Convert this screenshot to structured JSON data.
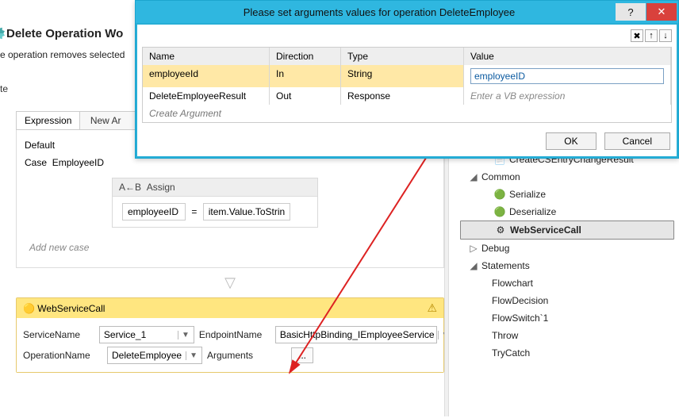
{
  "background": {
    "title": "Delete Operation Wo",
    "desc": "e operation removes selected",
    "te": "te"
  },
  "workflow": {
    "tab_expression": "Expression",
    "tab_newaction": "New Ar",
    "default_label": "Default",
    "case_label": "Case",
    "case_value": "EmployeeID",
    "assign": {
      "title": "Assign",
      "heading_icon": "A←B",
      "left": "employeeID",
      "eq": "=",
      "right": "item.Value.ToStrin"
    },
    "add_new_case": "Add new case",
    "down_glyph": "▽"
  },
  "service_call": {
    "title": "WebServiceCall",
    "warn_glyph": "⚠",
    "rows": {
      "service_name_label": "ServiceName",
      "service_name_value": "Service_1",
      "endpoint_label": "EndpointName",
      "endpoint_value": "BasicHttpBinding_IEmployeeService",
      "operation_label": "OperationName",
      "operation_value": "DeleteEmployee",
      "arguments_label": "Arguments",
      "arguments_value": "..."
    }
  },
  "tree": {
    "items": [
      {
        "icon": "",
        "label": "CreateCSEntryChangeResult",
        "caret": "",
        "indent": "indent2"
      },
      {
        "icon": "",
        "label": "Common",
        "caret": "◢",
        "indent": "indent1"
      },
      {
        "icon": "",
        "label": "Serialize",
        "caret": "",
        "indent": "indent2"
      },
      {
        "icon": "",
        "label": "Deserialize",
        "caret": "",
        "indent": "indent2"
      },
      {
        "icon": "",
        "label": "WebServiceCall",
        "caret": "",
        "indent": "indent2",
        "sel": true,
        "bold": true
      },
      {
        "icon": "",
        "label": "Debug",
        "caret": "▷",
        "indent": "indent1"
      },
      {
        "icon": "",
        "label": "Statements",
        "caret": "◢",
        "indent": "indent1"
      },
      {
        "icon": "",
        "label": "Flowchart",
        "caret": "",
        "indent": "indent2b"
      },
      {
        "icon": "",
        "label": "FlowDecision",
        "caret": "",
        "indent": "indent2b"
      },
      {
        "icon": "",
        "label": "FlowSwitch`1",
        "caret": "",
        "indent": "indent2b"
      },
      {
        "icon": "",
        "label": "Throw",
        "caret": "",
        "indent": "indent2b"
      },
      {
        "icon": "",
        "label": "TryCatch",
        "caret": "",
        "indent": "indent2b"
      }
    ]
  },
  "dialog": {
    "title": "Please set arguments values for operation DeleteEmployee",
    "help_glyph": "?",
    "close_glyph": "✕",
    "tools": {
      "del": "✖",
      "up": "↑",
      "down": "↓"
    },
    "headers": {
      "name": "Name",
      "direction": "Direction",
      "type": "Type",
      "value": "Value"
    },
    "rows": [
      {
        "name": "employeeId",
        "direction": "In",
        "type": "String",
        "value": "employeeID",
        "selected": true
      },
      {
        "name": "DeleteEmployeeResult",
        "direction": "Out",
        "type": "Response",
        "value_placeholder": "Enter a VB expression"
      }
    ],
    "create_argument": "Create Argument",
    "ok": "OK",
    "cancel": "Cancel"
  }
}
